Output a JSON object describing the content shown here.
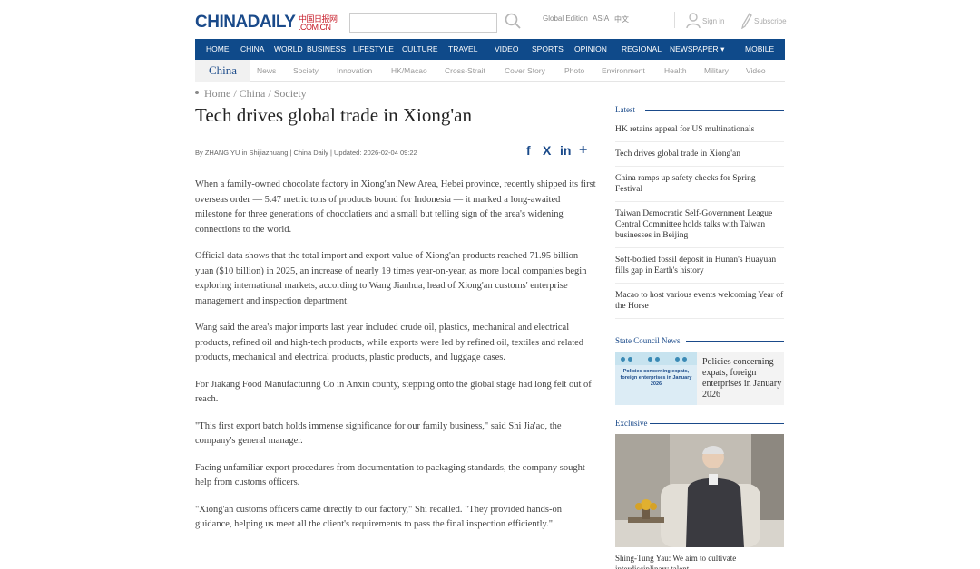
{
  "header": {
    "logo_main": "CHINADAILY",
    "logo_cn": "中国日报网",
    "logo_com": ".COM.CN",
    "search_placeholder": "",
    "editions": [
      "Global Edition",
      "ASIA",
      "中文"
    ],
    "sign_in": "Sign in",
    "subscribe": "Subscribe"
  },
  "main_nav": [
    "HOME",
    "CHINA",
    "WORLD",
    "BUSINESS",
    "LIFESTYLE",
    "CULTURE",
    "TRAVEL",
    "VIDEO",
    "SPORTS",
    "OPINION",
    "REGIONAL",
    "NEWSPAPER",
    "MOBILE"
  ],
  "newspaper_caret": "▾",
  "sub_nav": {
    "section": "China",
    "items": [
      "News",
      "Society",
      "Innovation",
      "HK/Macao",
      "Cross-Strait",
      "Cover Story",
      "Photo",
      "Environment",
      "Health",
      "Military",
      "Video"
    ]
  },
  "breadcrumb": [
    "Home",
    "China",
    "Society"
  ],
  "breadcrumb_sep": " / ",
  "article": {
    "title": "Tech drives global trade in Xiong'an",
    "byline": "By ZHANG YU in Shijiazhuang | China Daily | Updated: 2026-02-04 09:22",
    "share_icons": [
      "facebook-icon",
      "x-icon",
      "linkedin-icon",
      "plus-icon"
    ],
    "share_glyphs": [
      "f",
      "X",
      "in",
      "+"
    ],
    "paragraphs": [
      "When a family-owned chocolate factory in Xiong'an New Area, Hebei province, recently shipped its first overseas order — 5.47 metric tons of products bound for Indonesia — it marked a long-awaited milestone for three generations of chocolatiers and a small but telling sign of the area's widening connections to the world.",
      "Official data shows that the total import and export value of Xiong'an products reached 71.95 billion yuan ($10 billion) in 2025, an increase of nearly 19 times year-on-year, as more local companies begin exploring international markets, according to Wang Jianhua, head of Xiong'an customs' enterprise management and inspection department.",
      "Wang said the area's major imports last year included crude oil, plastics, mechanical and electrical products, refined oil and high-tech products, while exports were led by refined oil, textiles and related products, mechanical and electrical products, plastic products, and luggage cases.",
      "For Jiakang Food Manufacturing Co in Anxin county, stepping onto the global stage had long felt out of reach.",
      "\"This first export batch holds immense significance for our family business,\" said Shi Jia'ao, the company's general manager.",
      "Facing unfamiliar export procedures from documentation to packaging standards, the company sought help from customs officers.",
      "\"Xiong'an customs officers came directly to our factory,\" Shi recalled. \"They provided hands-on guidance, helping us meet all the client's requirements to pass the final inspection efficiently.\""
    ]
  },
  "sidebar": {
    "latest_title": "Latest",
    "latest": [
      "HK retains appeal for US multinationals",
      "Tech drives global trade in Xiong'an",
      "China ramps up safety checks for Spring Festival",
      "Taiwan Democratic Self-Government League Central Committee holds talks with Taiwan businesses in Beijing",
      "Soft-bodied fossil deposit in Hunan's Huayuan fills gap in Earth's history",
      "Macao to host various events welcoming Year of the Horse"
    ],
    "state_council_title": "State Council News",
    "state_council_image_caption": "Policies concerning expats, foreign enterprises in January 2026",
    "state_council_item": "Policies concerning expats, foreign enterprises in January 2026",
    "exclusive_title": "Exclusive",
    "exclusive_caption": "Shing-Tung Yau: We aim to cultivate interdisciplinary talent"
  },
  "colors": {
    "brand_blue": "#0f4a8a",
    "logo_red": "#c8202d",
    "body_text": "#444444"
  }
}
